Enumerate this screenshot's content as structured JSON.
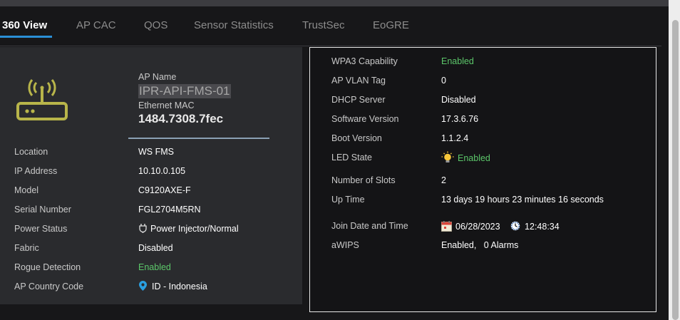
{
  "tabs": [
    {
      "label": "360 View",
      "active": true
    },
    {
      "label": "AP CAC"
    },
    {
      "label": "QOS"
    },
    {
      "label": "Sensor Statistics"
    },
    {
      "label": "TrustSec"
    },
    {
      "label": "EoGRE"
    }
  ],
  "ap_summary": {
    "name_label": "AP Name",
    "name_value": "IPR-API-FMS-01",
    "mac_label": "Ethernet MAC",
    "mac_value": "1484.7308.7fec",
    "icon": "wireless-router-icon"
  },
  "details_left": [
    {
      "label": "Location",
      "value": "WS FMS"
    },
    {
      "label": "IP Address",
      "value": "10.10.0.105"
    },
    {
      "label": "Model",
      "value": "C9120AXE-F"
    },
    {
      "label": "Serial Number",
      "value": "FGL2704M5RN"
    },
    {
      "label": "Power Status",
      "value": "Power Injector/Normal",
      "icon": "power-plug-icon"
    },
    {
      "label": "Fabric",
      "value": "Disabled"
    },
    {
      "label": "Rogue Detection",
      "value": "Enabled"
    },
    {
      "label": "AP Country Code",
      "value": "ID - Indonesia",
      "icon": "location-pin-icon"
    }
  ],
  "details_right": {
    "wpa3": {
      "label": "WPA3 Capability",
      "value": "Enabled"
    },
    "vlan": {
      "label": "AP VLAN Tag",
      "value": "0"
    },
    "dhcp": {
      "label": "DHCP Server",
      "value": "Disabled"
    },
    "software": {
      "label": "Software Version",
      "value": "17.3.6.76"
    },
    "boot": {
      "label": "Boot Version",
      "value": "1.1.2.4"
    },
    "led": {
      "label": "LED State",
      "value": "Enabled",
      "icon": "lightbulb-icon"
    },
    "slots": {
      "label": "Number of Slots",
      "value": "2"
    },
    "uptime": {
      "label": "Up Time",
      "value": "13 days 19 hours 23 minutes 16 seconds"
    },
    "join": {
      "label": "Join Date and Time",
      "date": "06/28/2023",
      "time": "12:48:34",
      "date_icon": "calendar-icon",
      "time_icon": "clock-icon"
    },
    "awips": {
      "label": "aWIPS",
      "value": "Enabled,",
      "alarms": "0 Alarms"
    }
  },
  "colors": {
    "accent": "#2a8fd6",
    "enabled_green": "#5cc76a",
    "icon_olive": "#b8b54a",
    "panel_bg": "#2a2b2e",
    "page_bg": "#171719"
  }
}
